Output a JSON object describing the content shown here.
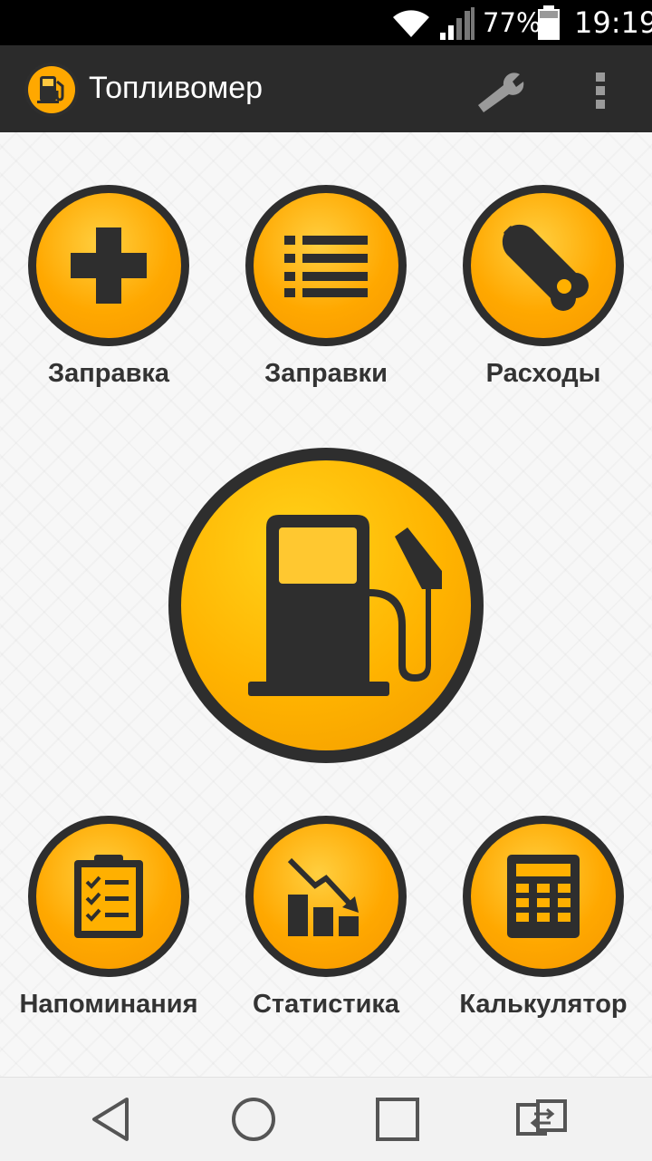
{
  "status_bar": {
    "battery_percent": "77%",
    "time": "19:19",
    "icons": [
      "wifi-icon",
      "signal-icon",
      "battery-icon"
    ]
  },
  "app_bar": {
    "title": "Топливомер",
    "icons": [
      "fuel-pump-logo-icon",
      "wrench-icon",
      "overflow-menu-icon"
    ]
  },
  "colors": {
    "accent": "#ffa800",
    "dark": "#2e2e2e",
    "app_bar_bg": "#2b2b2b"
  },
  "tiles_top": [
    {
      "label": "Заправка",
      "icon": "plus-icon"
    },
    {
      "label": "Заправки",
      "icon": "list-icon"
    },
    {
      "label": "Расходы",
      "icon": "wrench-icon"
    }
  ],
  "center_button": {
    "icon": "fuel-pump-icon"
  },
  "tiles_bottom": [
    {
      "label": "Напоминания",
      "icon": "clipboard-checklist-icon"
    },
    {
      "label": "Статистика",
      "icon": "trend-down-chart-icon"
    },
    {
      "label": "Калькулятор",
      "icon": "calculator-icon"
    }
  ],
  "nav_bar": {
    "icons": [
      "back-icon",
      "home-icon",
      "recents-icon",
      "switch-apps-icon"
    ]
  }
}
